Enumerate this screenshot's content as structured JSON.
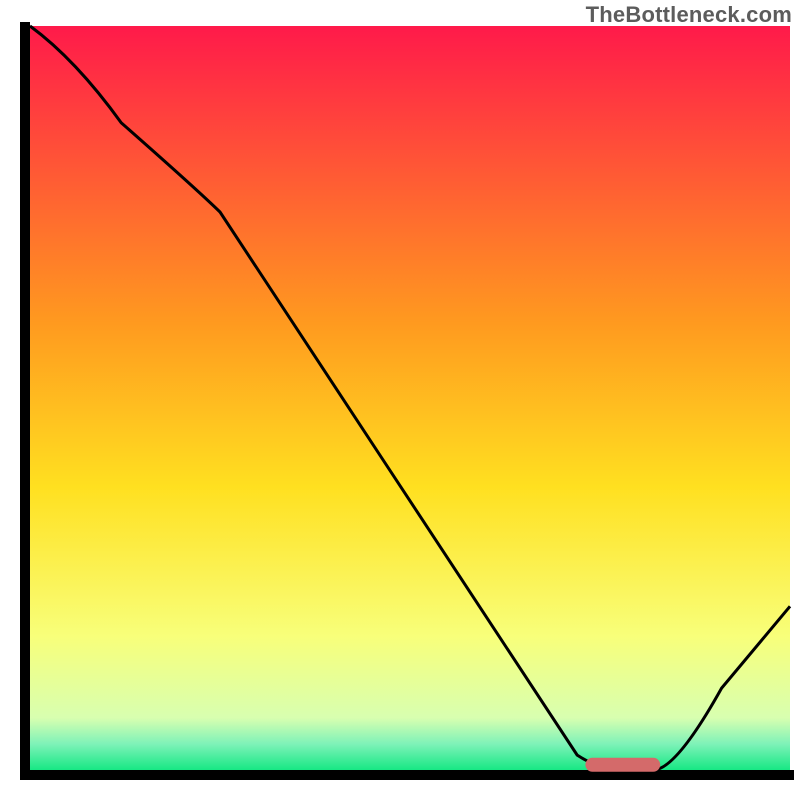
{
  "watermark": "TheBottleneck.com",
  "chart_data": {
    "type": "line",
    "title": "",
    "xlabel": "",
    "ylabel": "",
    "xlim": [
      0,
      100
    ],
    "ylim": [
      0,
      100
    ],
    "x": [
      0,
      12,
      25,
      72,
      78,
      82,
      100
    ],
    "y": [
      100,
      87,
      75,
      2,
      0,
      0,
      22
    ],
    "marker": {
      "x_start": 74,
      "x_end": 82,
      "y": 0.7
    },
    "gradient_stops": [
      {
        "offset": 0,
        "color": "#ff1a4a"
      },
      {
        "offset": 0.4,
        "color": "#ff9a1f"
      },
      {
        "offset": 0.62,
        "color": "#ffe020"
      },
      {
        "offset": 0.82,
        "color": "#f8ff7a"
      },
      {
        "offset": 0.93,
        "color": "#d8ffb0"
      },
      {
        "offset": 0.965,
        "color": "#7ef2b8"
      },
      {
        "offset": 1.0,
        "color": "#17e884"
      }
    ],
    "axis_thickness": 10,
    "curve_thickness": 3,
    "marker_color": "#d46a6a",
    "marker_thickness": 14
  }
}
